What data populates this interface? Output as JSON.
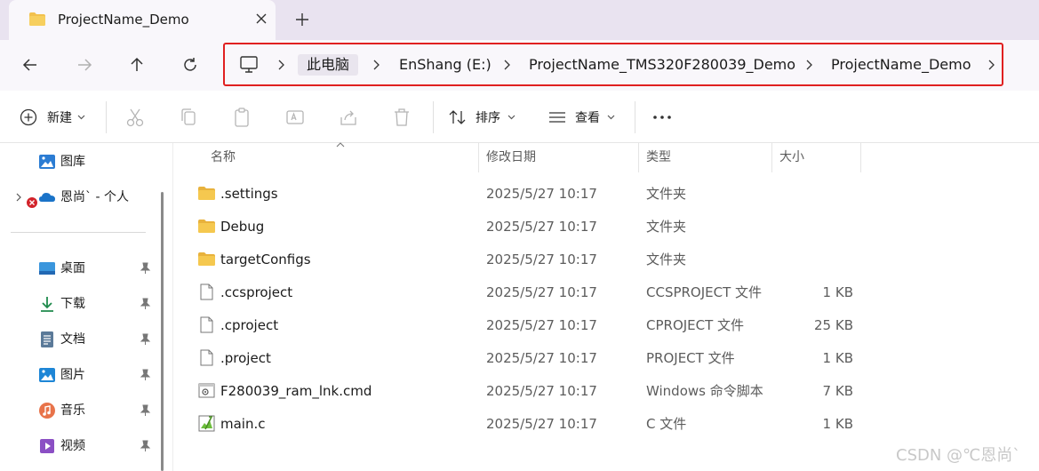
{
  "tab": {
    "title": "ProjectName_Demo"
  },
  "address": {
    "crumbs": [
      "此电脑",
      "EnShang (E:)",
      "ProjectName_TMS320F280039_Demo",
      "ProjectName_Demo"
    ]
  },
  "commands": {
    "new": "新建",
    "sort": "排序",
    "view": "查看"
  },
  "sidebar": {
    "items": [
      {
        "label": "图库",
        "icon": "gallery-icon"
      },
      {
        "label": "恩尚` - 个人",
        "icon": "onedrive-icon"
      },
      {
        "label": "桌面",
        "icon": "desktop-icon"
      },
      {
        "label": "下载",
        "icon": "download-icon"
      },
      {
        "label": "文档",
        "icon": "documents-icon"
      },
      {
        "label": "图片",
        "icon": "pictures-icon"
      },
      {
        "label": "音乐",
        "icon": "music-icon"
      },
      {
        "label": "视频",
        "icon": "videos-icon"
      }
    ]
  },
  "columns": {
    "name": "名称",
    "date": "修改日期",
    "type": "类型",
    "size": "大小"
  },
  "files": [
    {
      "name": ".settings",
      "date": "2025/5/27 10:17",
      "type": "文件夹",
      "size": "",
      "icon": "folder-icon"
    },
    {
      "name": "Debug",
      "date": "2025/5/27 10:17",
      "type": "文件夹",
      "size": "",
      "icon": "folder-icon"
    },
    {
      "name": "targetConfigs",
      "date": "2025/5/27 10:17",
      "type": "文件夹",
      "size": "",
      "icon": "folder-icon"
    },
    {
      "name": ".ccsproject",
      "date": "2025/5/27 10:17",
      "type": "CCSPROJECT 文件",
      "size": "1 KB",
      "icon": "file-icon"
    },
    {
      "name": ".cproject",
      "date": "2025/5/27 10:17",
      "type": "CPROJECT 文件",
      "size": "25 KB",
      "icon": "file-icon"
    },
    {
      "name": ".project",
      "date": "2025/5/27 10:17",
      "type": "PROJECT 文件",
      "size": "1 KB",
      "icon": "file-icon"
    },
    {
      "name": "F280039_ram_lnk.cmd",
      "date": "2025/5/27 10:17",
      "type": "Windows 命令脚本",
      "size": "7 KB",
      "icon": "cmd-script-icon"
    },
    {
      "name": "main.c",
      "date": "2025/5/27 10:17",
      "type": "C 文件",
      "size": "1 KB",
      "icon": "c-source-icon"
    }
  ],
  "watermark": "CSDN @℃恩尚`",
  "colors": {
    "highlight_border": "#e02020",
    "folder": "#f2c14e",
    "accent": "#0067c0"
  }
}
